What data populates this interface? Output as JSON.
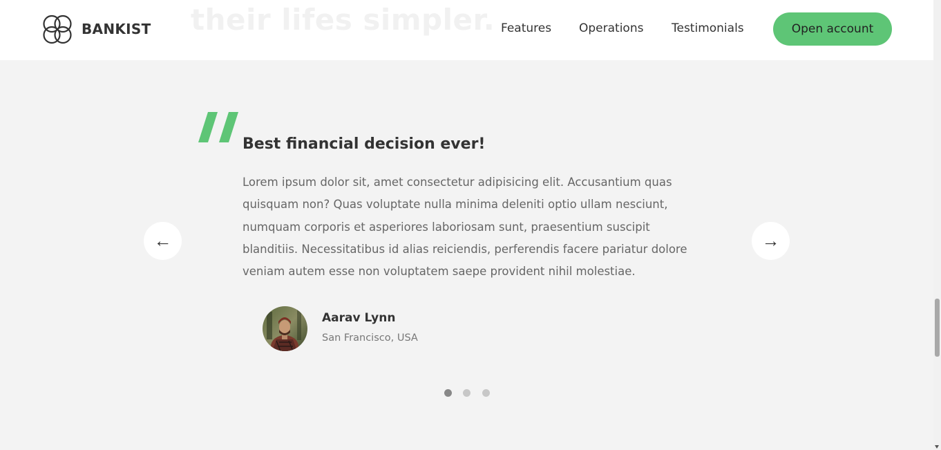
{
  "header": {
    "brand": "BANKIST",
    "background_heading": "their lifes simpler.",
    "nav_links": [
      "Features",
      "Operations",
      "Testimonials"
    ],
    "cta_label": "Open account",
    "accent_color": "#5ec576"
  },
  "testimonial": {
    "quote_icon": "quote-icon",
    "title": "Best financial decision ever!",
    "body": "Lorem ipsum dolor sit, amet consectetur adipisicing elit. Accusantium quas quisquam non? Quas voluptate nulla minima deleniti optio ullam nesciunt, numquam corporis et asperiores laboriosam sunt, praesentium suscipit blanditiis. Necessitatibus id alias reiciendis, perferendis facere pariatur dolore veniam autem esse non voluptatem saepe provident nihil molestiae.",
    "author": {
      "name": "Aarav Lynn",
      "location": "San Francisco, USA"
    }
  },
  "slider": {
    "prev_label": "←",
    "next_label": "→",
    "dots_count": 3,
    "active_dot": 1
  }
}
